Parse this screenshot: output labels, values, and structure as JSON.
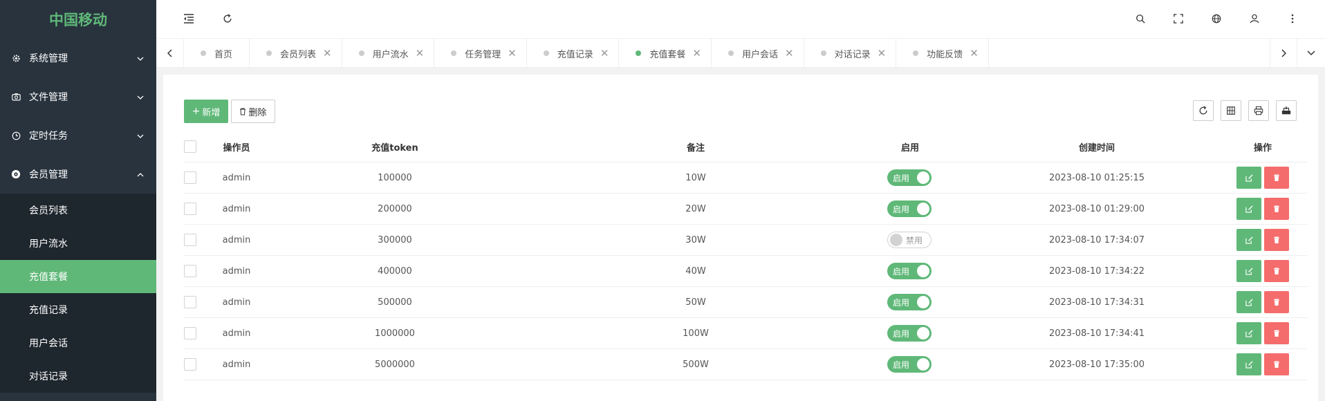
{
  "app": {
    "logo": "中国移动"
  },
  "sidebar": {
    "groups": [
      {
        "label": "系统管理",
        "icon": "gear-icon"
      },
      {
        "label": "文件管理",
        "icon": "camera-icon"
      },
      {
        "label": "定时任务",
        "icon": "clock-icon"
      },
      {
        "label": "会员管理",
        "icon": "eye-icon"
      }
    ],
    "sub_items": [
      {
        "label": "会员列表"
      },
      {
        "label": "用户流水"
      },
      {
        "label": "充值套餐"
      },
      {
        "label": "充值记录"
      },
      {
        "label": "用户会话"
      },
      {
        "label": "对话记录"
      }
    ]
  },
  "tabs": [
    {
      "label": "首页",
      "closable": false
    },
    {
      "label": "会员列表"
    },
    {
      "label": "用户流水"
    },
    {
      "label": "任务管理"
    },
    {
      "label": "充值记录"
    },
    {
      "label": "充值套餐",
      "active": true
    },
    {
      "label": "用户会话"
    },
    {
      "label": "对话记录"
    },
    {
      "label": "功能反馈"
    }
  ],
  "toolbar": {
    "add_label": "新增",
    "delete_label": "删除"
  },
  "table": {
    "headers": {
      "operator": "操作员",
      "token": "充值token",
      "note": "备注",
      "enabled": "启用",
      "created": "创建时间",
      "actions": "操作"
    },
    "rows": [
      {
        "operator": "admin",
        "token": "100000",
        "note": "10W",
        "enabled": true,
        "status": "启用",
        "created": "2023-08-10 01:25:15"
      },
      {
        "operator": "admin",
        "token": "200000",
        "note": "20W",
        "enabled": true,
        "status": "启用",
        "created": "2023-08-10 01:29:00"
      },
      {
        "operator": "admin",
        "token": "300000",
        "note": "30W",
        "enabled": false,
        "status": "禁用",
        "created": "2023-08-10 17:34:07"
      },
      {
        "operator": "admin",
        "token": "400000",
        "note": "40W",
        "enabled": true,
        "status": "启用",
        "created": "2023-08-10 17:34:22"
      },
      {
        "operator": "admin",
        "token": "500000",
        "note": "50W",
        "enabled": true,
        "status": "启用",
        "created": "2023-08-10 17:34:31"
      },
      {
        "operator": "admin",
        "token": "1000000",
        "note": "100W",
        "enabled": true,
        "status": "启用",
        "created": "2023-08-10 17:34:41"
      },
      {
        "operator": "admin",
        "token": "5000000",
        "note": "500W",
        "enabled": true,
        "status": "启用",
        "created": "2023-08-10 17:35:00"
      }
    ]
  },
  "colors": {
    "accent": "#5fb878",
    "danger": "#f56c6c",
    "sidebar_bg": "#28333e"
  }
}
